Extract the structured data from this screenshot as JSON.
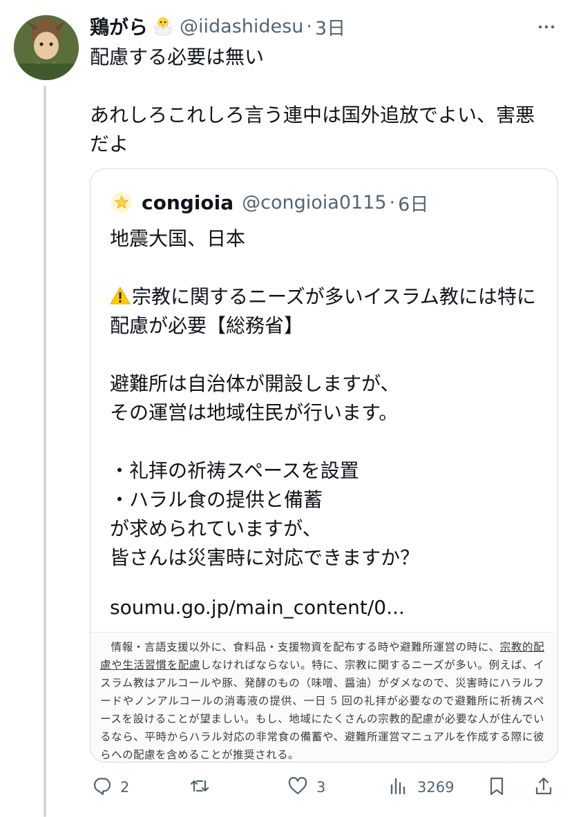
{
  "tweet": {
    "author_name": "鶏がら",
    "name_emoji": "hatching-chick-icon",
    "handle": "@iidashidesu",
    "separator": "·",
    "time": "3日",
    "text": "配慮する必要は無い\n\nあれしろこれしろ言う連中は国外追放でよい、害悪だよ"
  },
  "quote": {
    "author_name": "congioia",
    "avatar_icon": "star-icon",
    "handle": "@congioia0115",
    "separator": "·",
    "time": "6日",
    "line1": "地震大国、日本",
    "warning_icon": "warning-icon",
    "body_after_warning": "宗教に関するニーズが多いイスラム教には特に配慮が必要【総務省】\n\n避難所は自治体が開設しますが、\nその運営は地域住民が行います。\n\n・礼拝の祈祷スペースを設置\n・ハラル食の提供と備蓄\nが求められていますが、\n皆さんは災害時に対応できますか？",
    "link_text": "soumu.go.jp/main_content/0...",
    "document_excerpt": {
      "before_ul": "情報・言語支援以外に、食料品・支援物資を配布する時や避難所運営の時に、",
      "underlined": "宗教的配慮や生活習慣を配慮",
      "after_ul": "しなければならない。特に、宗教に関するニーズが多い。例えば、イスラム教はアルコールや豚、発酵のもの（味噌、醤油）がダメなので、災害時にハラルフードやノンアルコールの消毒液の提供、一日 5 回の礼拝が必要なので避難所に祈祷スペースを設けることが望ましい。もし、地域にたくさんの宗教的配慮が必要な人が住んでいるなら、平時からハラル対応の非常食の備蓄や、避難所運営マニュアルを作成する際に彼らへの配慮を含めることが推奨される。"
    }
  },
  "actions": {
    "reply_count": "2",
    "retweet_count": "",
    "like_count": "3",
    "view_count": "3269"
  },
  "icons": {
    "reply": "reply-icon",
    "retweet": "retweet-icon",
    "like": "heart-icon",
    "views": "views-icon",
    "bookmark": "bookmark-icon",
    "share": "share-icon",
    "more": "more-icon"
  },
  "colors": {
    "text": "#0f1419",
    "secondary": "#536471",
    "border": "#cfd9de"
  }
}
